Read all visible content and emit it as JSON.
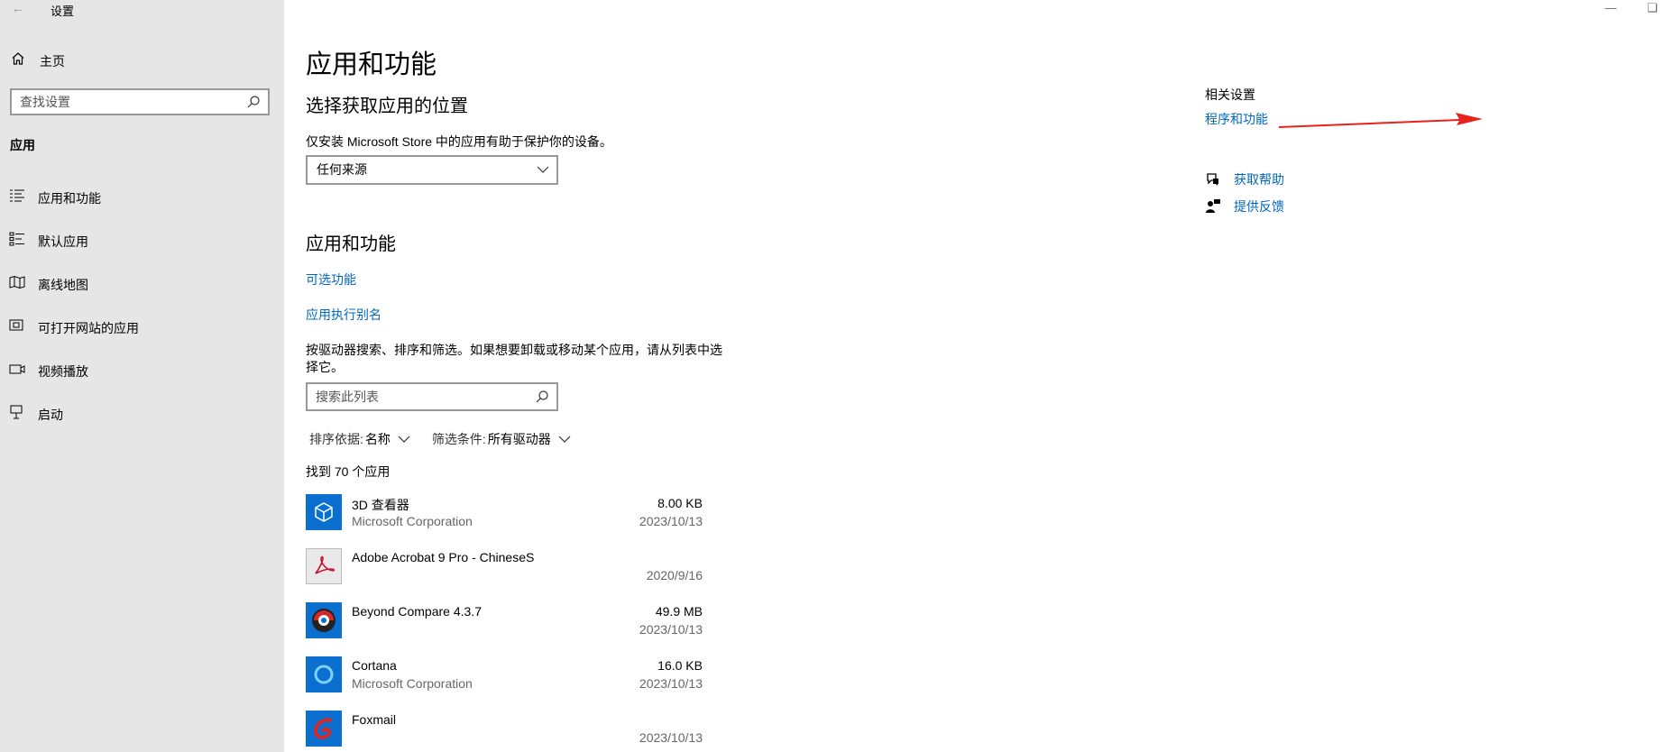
{
  "window": {
    "title": "设置",
    "back_icon": "back-arrow-icon"
  },
  "sidebar": {
    "home_label": "主页",
    "search_placeholder": "查找设置",
    "section_title": "应用",
    "items": [
      {
        "label": "应用和功能",
        "icon": "apps-features-icon"
      },
      {
        "label": "默认应用",
        "icon": "default-apps-icon"
      },
      {
        "label": "离线地图",
        "icon": "offline-maps-icon"
      },
      {
        "label": "可打开网站的应用",
        "icon": "apps-for-websites-icon"
      },
      {
        "label": "视频播放",
        "icon": "video-playback-icon"
      },
      {
        "label": "启动",
        "icon": "startup-icon"
      }
    ]
  },
  "main": {
    "title": "应用和功能",
    "choose_location_title": "选择获取应用的位置",
    "choose_location_desc": "仅安装 Microsoft Store 中的应用有助于保护你的设备。",
    "source_dropdown_value": "任何来源",
    "apps_heading": "应用和功能",
    "optional_features_link": "可选功能",
    "app_alias_link": "应用执行别名",
    "list_desc": "按驱动器搜索、排序和筛选。如果想要卸载或移动某个应用，请从列表中选择它。",
    "list_search_placeholder": "搜索此列表",
    "sort_label": "排序依据:",
    "sort_value": "名称",
    "filter_label": "筛选条件:",
    "filter_value": "所有驱动器",
    "found_text": "找到 70 个应用",
    "apps": [
      {
        "name": "3D 查看器",
        "publisher": "Microsoft Corporation",
        "size": "8.00 KB",
        "date": "2023/10/13",
        "icon": "3d-viewer-icon"
      },
      {
        "name": "Adobe Acrobat 9 Pro - ChineseS",
        "publisher": "",
        "size": "",
        "date": "2020/9/16",
        "icon": "adobe-acrobat-icon"
      },
      {
        "name": "Beyond Compare 4.3.7",
        "publisher": "",
        "size": "49.9 MB",
        "date": "2023/10/13",
        "icon": "beyond-compare-icon"
      },
      {
        "name": "Cortana",
        "publisher": "Microsoft Corporation",
        "size": "16.0 KB",
        "date": "2023/10/13",
        "icon": "cortana-icon"
      },
      {
        "name": "Foxmail",
        "publisher": "",
        "size": "",
        "date": "2023/10/13",
        "icon": "foxmail-icon"
      }
    ]
  },
  "related": {
    "title": "相关设置",
    "programs_link": "程序和功能",
    "help_link": "获取帮助",
    "feedback_link": "提供反馈"
  },
  "colors": {
    "sidebar_bg": "#e6e6e6",
    "link": "#0067c0",
    "accent_tile": "#0b6fd0",
    "annotation_arrow": "#e8231b"
  }
}
